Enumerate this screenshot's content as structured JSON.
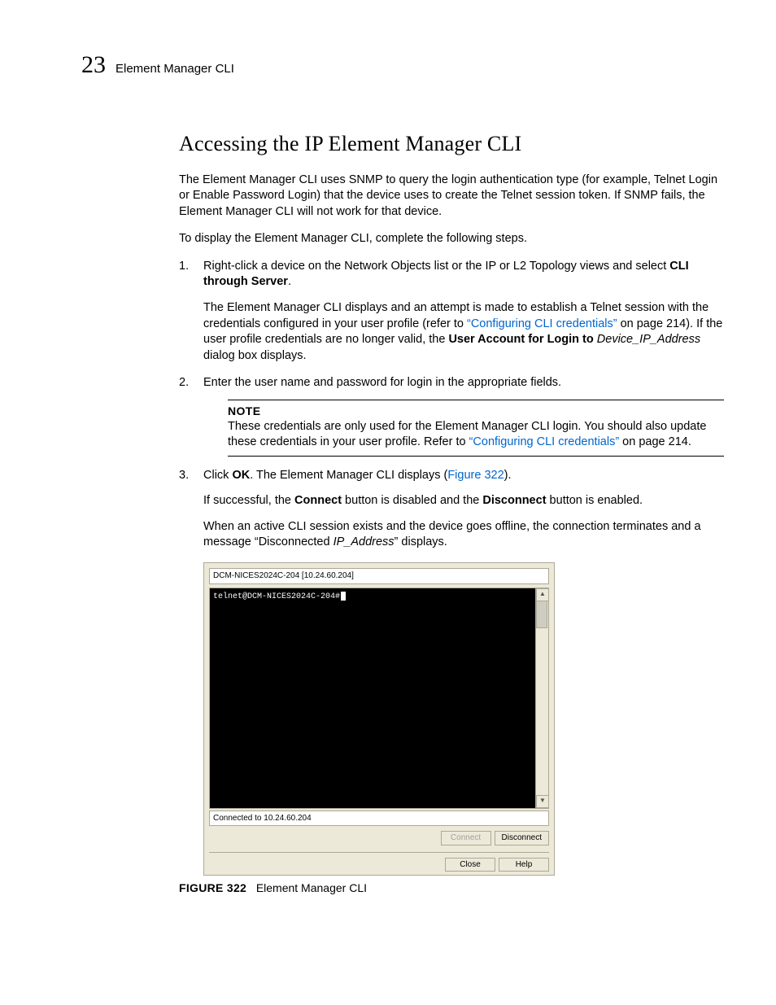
{
  "header": {
    "chapter_number": "23",
    "running_title": "Element Manager CLI"
  },
  "section": {
    "title": "Accessing the IP Element Manager CLI",
    "intro1": "The Element Manager CLI uses SNMP to query the login authentication type (for example, Telnet Login or Enable Password Login) that the device uses to create the Telnet session token. If SNMP fails, the Element Manager CLI will not work for that device.",
    "intro2": "To display the Element Manager CLI, complete the following steps."
  },
  "steps": {
    "s1_pre": "Right-click a device on the Network Objects list or the IP or L2 Topology views and select ",
    "s1_bold": "CLI through Server",
    "s1_suffix": ".",
    "s1b_pre": "The Element Manager CLI displays and an attempt is made to establish a Telnet session with the credentials configured in your user profile (refer to ",
    "s1b_link": "“Configuring CLI credentials”",
    "s1b_mid": " on page 214). If the user profile credentials are no longer valid, the ",
    "s1b_bold": "User Account for Login to ",
    "s1b_italic": "Device_IP_Address",
    "s1b_end": " dialog box displays.",
    "s2": "Enter the user name and password for login in the appropriate fields.",
    "s3_pre": "Click ",
    "s3_bold": "OK",
    "s3_mid": ". The Element Manager CLI displays (",
    "s3_link": "Figure 322",
    "s3_end": ").",
    "s3b_pre": "If successful, the ",
    "s3b_b1": "Connect",
    "s3b_mid": " button is disabled and the ",
    "s3b_b2": "Disconnect",
    "s3b_end": " button is enabled.",
    "s3c_pre": "When an active CLI session exists and the device goes offline, the connection terminates and a message “Disconnected ",
    "s3c_italic": "IP_Address",
    "s3c_end": "” displays."
  },
  "note": {
    "label": "NOTE",
    "text_pre": "These credentials are only used for the Element Manager CLI login. You should also update these credentials in your user profile. Refer to ",
    "text_link": "“Configuring CLI credentials”",
    "text_end": " on page 214."
  },
  "cli": {
    "title": "DCM-NICES2024C-204 [10.24.60.204]",
    "terminal_line": "telnet@DCM-NICES2024C-204#",
    "status": "Connected to 10.24.60.204",
    "buttons": {
      "connect": "Connect",
      "disconnect": "Disconnect",
      "close": "Close",
      "help": "Help"
    }
  },
  "figure": {
    "label": "FIGURE 322",
    "caption": "Element Manager CLI"
  }
}
